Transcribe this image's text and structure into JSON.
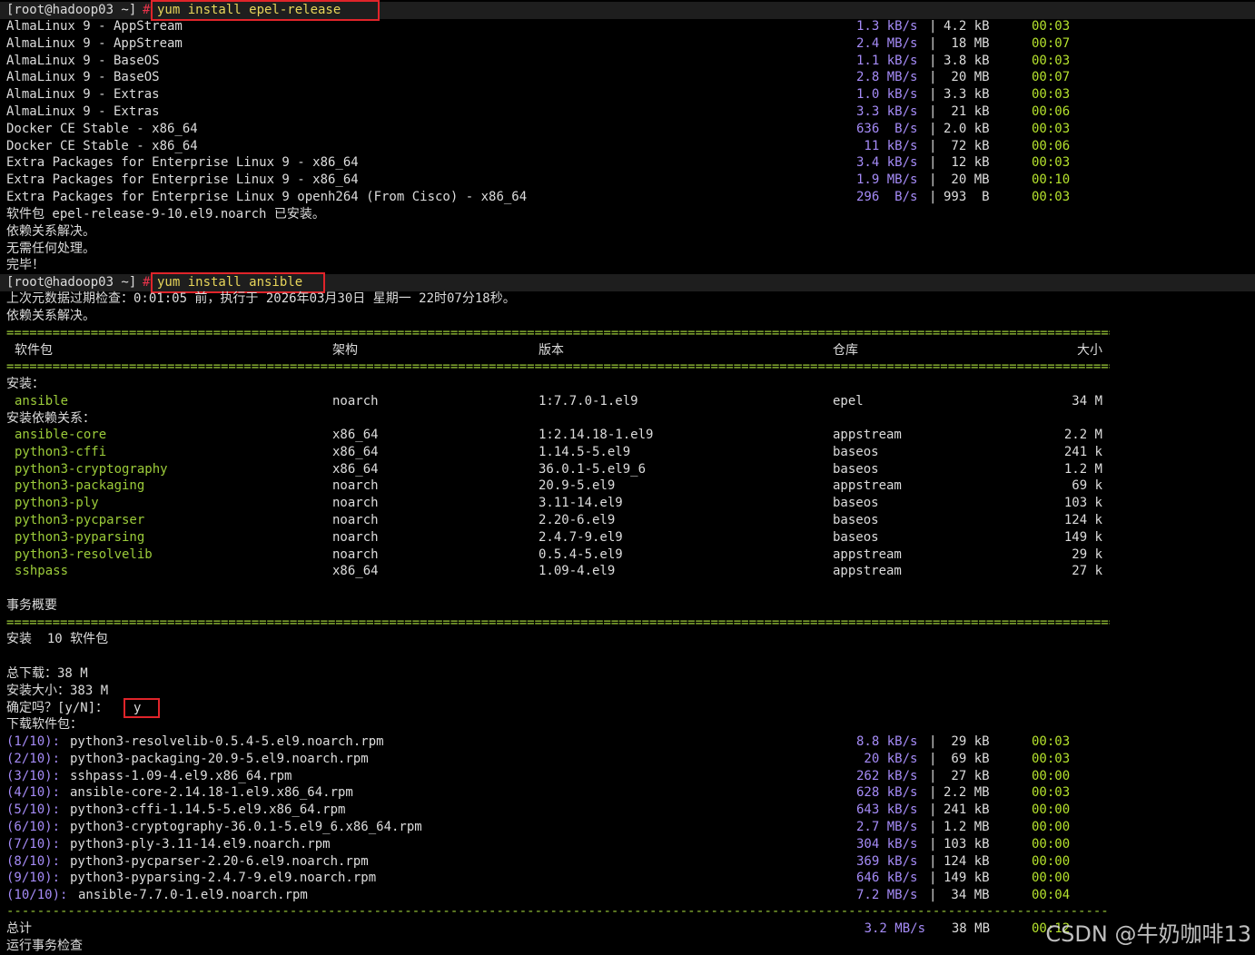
{
  "window": {
    "title": "[root@hadoop03 ~]#"
  },
  "colors": {
    "background": "#000000",
    "prompt_highlight": "#e0242a",
    "package_name": "#9ccc3a",
    "number": "#a58bf7",
    "time": "#b5e22d"
  },
  "prompt1": {
    "prompt": "[root@hadoop03 ~]",
    "hash": "#",
    "command": "yum install epel-release"
  },
  "repos": [
    {
      "name": "AlmaLinux 9 - AppStream",
      "speed": "1.3 kB/s",
      "size": "4.2 kB",
      "time": "00:03"
    },
    {
      "name": "AlmaLinux 9 - AppStream",
      "speed": "2.4 MB/s",
      "size": " 18 MB",
      "time": "00:07"
    },
    {
      "name": "AlmaLinux 9 - BaseOS",
      "speed": "1.1 kB/s",
      "size": "3.8 kB",
      "time": "00:03"
    },
    {
      "name": "AlmaLinux 9 - BaseOS",
      "speed": "2.8 MB/s",
      "size": " 20 MB",
      "time": "00:07"
    },
    {
      "name": "AlmaLinux 9 - Extras",
      "speed": "1.0 kB/s",
      "size": "3.3 kB",
      "time": "00:03"
    },
    {
      "name": "AlmaLinux 9 - Extras",
      "speed": "3.3 kB/s",
      "size": " 21 kB",
      "time": "00:06"
    },
    {
      "name": "Docker CE Stable - x86_64",
      "speed": "636  B/s",
      "size": "2.0 kB",
      "time": "00:03"
    },
    {
      "name": "Docker CE Stable - x86_64",
      "speed": " 11 kB/s",
      "size": " 72 kB",
      "time": "00:06"
    },
    {
      "name": "Extra Packages for Enterprise Linux 9 - x86_64",
      "speed": "3.4 kB/s",
      "size": " 12 kB",
      "time": "00:03"
    },
    {
      "name": "Extra Packages for Enterprise Linux 9 - x86_64",
      "speed": "1.9 MB/s",
      "size": " 20 MB",
      "time": "00:10"
    },
    {
      "name": "Extra Packages for Enterprise Linux 9 openh264 (From Cisco) - x86_64",
      "speed": "296  B/s",
      "size": "993  B",
      "time": "00:03"
    }
  ],
  "epel_result": [
    "软件包 epel-release-9-10.el9.noarch 已安装。",
    "依赖关系解决。",
    "无需任何处理。",
    "完毕！"
  ],
  "prompt2": {
    "prompt": "[root@hadoop03 ~]",
    "hash": "#",
    "command": "yum install ansible"
  },
  "metadata_line": "上次元数据过期检查：0:01:05 前，执行于 2026年03月30日 星期一 22时07分18秒。",
  "deps_resolved": "依赖关系解决。",
  "separator": "==================================================================================================================================================================================================================",
  "table": {
    "headers": {
      "package": "软件包",
      "arch": "架构",
      "version": "版本",
      "repo": "仓库",
      "size": "大小"
    },
    "install_label": "安装：",
    "install": [
      {
        "name": "ansible",
        "arch": "noarch",
        "version": "1:7.7.0-1.el9",
        "repo": "epel",
        "size": "34 M"
      }
    ],
    "deps_label": "安装依赖关系：",
    "deps": [
      {
        "name": "ansible-core",
        "arch": "x86_64",
        "version": "1:2.14.18-1.el9",
        "repo": "appstream",
        "size": "2.2 M"
      },
      {
        "name": "python3-cffi",
        "arch": "x86_64",
        "version": "1.14.5-5.el9",
        "repo": "baseos",
        "size": "241 k"
      },
      {
        "name": "python3-cryptography",
        "arch": "x86_64",
        "version": "36.0.1-5.el9_6",
        "repo": "baseos",
        "size": "1.2 M"
      },
      {
        "name": "python3-packaging",
        "arch": "noarch",
        "version": "20.9-5.el9",
        "repo": "appstream",
        "size": "69 k"
      },
      {
        "name": "python3-ply",
        "arch": "noarch",
        "version": "3.11-14.el9",
        "repo": "baseos",
        "size": "103 k"
      },
      {
        "name": "python3-pycparser",
        "arch": "noarch",
        "version": "2.20-6.el9",
        "repo": "baseos",
        "size": "124 k"
      },
      {
        "name": "python3-pyparsing",
        "arch": "noarch",
        "version": "2.4.7-9.el9",
        "repo": "baseos",
        "size": "149 k"
      },
      {
        "name": "python3-resolvelib",
        "arch": "noarch",
        "version": "0.5.4-5.el9",
        "repo": "appstream",
        "size": "29 k"
      },
      {
        "name": "sshpass",
        "arch": "x86_64",
        "version": "1.09-4.el9",
        "repo": "appstream",
        "size": "27 k"
      }
    ]
  },
  "summary": {
    "title": "事务概要",
    "install_line": "安装  10 软件包",
    "total_download": "总下载：38 M",
    "install_size": "安装大小：383 M",
    "confirm_prompt": "确定吗？[y/N]：",
    "confirm_answer": "y",
    "downloading": "下载软件包："
  },
  "downloads": [
    {
      "idx": "(1/10):",
      "file": "python3-resolvelib-0.5.4-5.el9.noarch.rpm",
      "speed": "8.8 kB/s",
      "size": " 29 kB",
      "time": "00:03"
    },
    {
      "idx": "(2/10):",
      "file": "python3-packaging-20.9-5.el9.noarch.rpm",
      "speed": " 20 kB/s",
      "size": " 69 kB",
      "time": "00:03"
    },
    {
      "idx": "(3/10):",
      "file": "sshpass-1.09-4.el9.x86_64.rpm",
      "speed": "262 kB/s",
      "size": " 27 kB",
      "time": "00:00"
    },
    {
      "idx": "(4/10):",
      "file": "ansible-core-2.14.18-1.el9.x86_64.rpm",
      "speed": "628 kB/s",
      "size": "2.2 MB",
      "time": "00:03"
    },
    {
      "idx": "(5/10):",
      "file": "python3-cffi-1.14.5-5.el9.x86_64.rpm",
      "speed": "643 kB/s",
      "size": "241 kB",
      "time": "00:00"
    },
    {
      "idx": "(6/10):",
      "file": "python3-cryptography-36.0.1-5.el9_6.x86_64.rpm",
      "speed": "2.7 MB/s",
      "size": "1.2 MB",
      "time": "00:00"
    },
    {
      "idx": "(7/10):",
      "file": "python3-ply-3.11-14.el9.noarch.rpm",
      "speed": "304 kB/s",
      "size": "103 kB",
      "time": "00:00"
    },
    {
      "idx": "(8/10):",
      "file": "python3-pycparser-2.20-6.el9.noarch.rpm",
      "speed": "369 kB/s",
      "size": "124 kB",
      "time": "00:00"
    },
    {
      "idx": "(9/10):",
      "file": "python3-pyparsing-2.4.7-9.el9.noarch.rpm",
      "speed": "646 kB/s",
      "size": "149 kB",
      "time": "00:00"
    },
    {
      "idx": "(10/10):",
      "file": "ansible-7.7.0-1.el9.noarch.rpm",
      "speed": "7.2 MB/s",
      "size": " 34 MB",
      "time": "00:04"
    }
  ],
  "dash_separator": "--------------------------------------------------------------------------------------------------------------------------------------------------------------------------------------------------------------------",
  "total": {
    "label": "总计",
    "speed": "3.2 MB/s",
    "size": " 38 MB",
    "time": "00:12"
  },
  "running_check": "运行事务检查",
  "watermark": "CSDN @牛奶咖啡13"
}
